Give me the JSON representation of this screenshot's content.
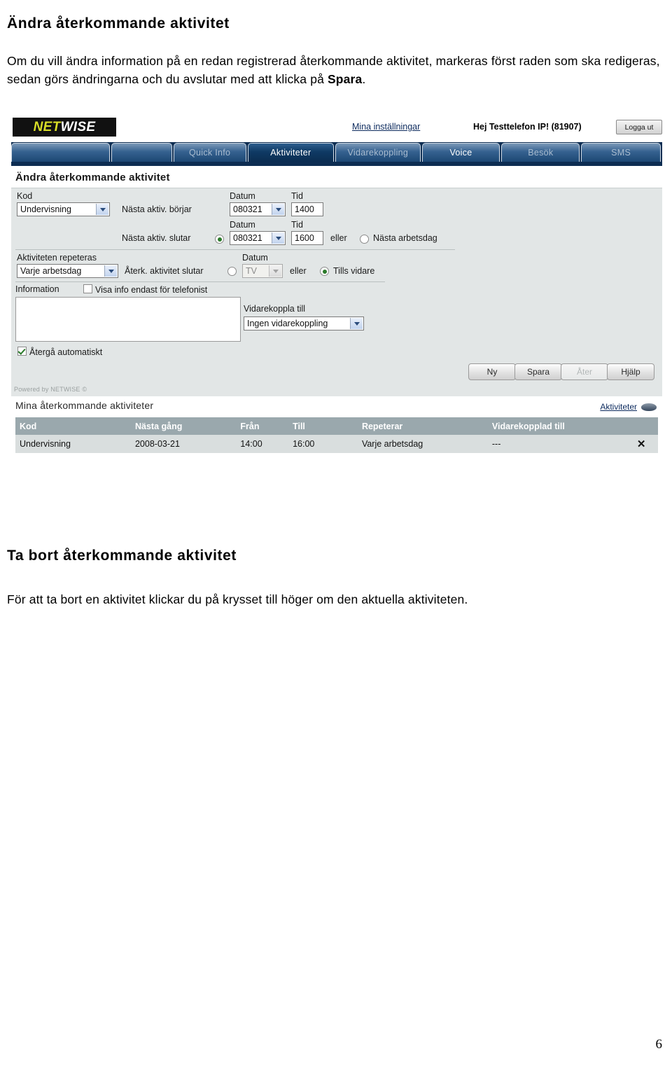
{
  "document": {
    "heading_change": "Ändra återkommande aktivitet",
    "para_change_part1": "Om du vill ändra information på en redan registrerad återkommande aktivitet, markeras först raden som ska redigeras, sedan görs ändringarna och du avslutar med att klicka på ",
    "para_change_bold": "Spara",
    "para_change_part2": ".",
    "heading_delete": "Ta bort återkommande aktivitet",
    "para_delete": "För att ta bort en aktivitet klickar du på krysset till höger om den aktuella aktiviteten.",
    "page_number": "6"
  },
  "app": {
    "logo": {
      "part_a": "NET",
      "part_b": "WISE",
      "color_a": "#d8dd27",
      "color_b": "#ffffff",
      "background": "#111111"
    },
    "header": {
      "settings_link": "Mina inställningar",
      "greeting": "Hej Testtelefon IP! (81907)",
      "logout_label": "Logga ut"
    },
    "nav_tabs": [
      {
        "label": "",
        "state": "blank"
      },
      {
        "label": "",
        "state": "blank"
      },
      {
        "label": "Quick Info",
        "state": "normal"
      },
      {
        "label": "Aktiviteter",
        "state": "active"
      },
      {
        "label": "Vidarekoppling",
        "state": "normal"
      },
      {
        "label": "Voice",
        "state": "bright"
      },
      {
        "label": "Besök",
        "state": "normal"
      },
      {
        "label": "SMS",
        "state": "normal"
      }
    ],
    "page_title": "Ändra återkommande aktivitet",
    "form": {
      "kod_label": "Kod",
      "kod_value": "Undervisning",
      "start_label": "Nästa aktiv. börjar",
      "start_date_label": "Datum",
      "start_time_label": "Tid",
      "start_date_value": "080321",
      "start_time_value": "1400",
      "end_label": "Nästa aktiv. slutar",
      "end_date_label": "Datum",
      "end_time_label": "Tid",
      "end_date_value": "080321",
      "end_time_value": "1600",
      "or_label_1": "eller",
      "next_workday_label": "Nästa arbetsdag",
      "repeat_label": "Aktiviteten repeteras",
      "repeat_value": "Varje arbetsdag",
      "repeat_end_label": "Återk. aktivitet slutar",
      "repeat_date_label": "Datum",
      "repeat_date_value": "TV",
      "or_label_2": "eller",
      "until_further_label": "Tills vidare",
      "information_label": "Information",
      "operator_only_label": "Visa info endast för telefonist",
      "info_text_value": "",
      "forward_to_label": "Vidarekoppla till",
      "forward_to_value": "Ingen vidarekoppling",
      "auto_return_label": "Återgå automatiskt",
      "powered_by": "Powered by NETWISE ©",
      "buttons": [
        {
          "label": "Ny",
          "disabled": false
        },
        {
          "label": "Spara",
          "disabled": false
        },
        {
          "label": "Åter",
          "disabled": true
        },
        {
          "label": "Hjälp",
          "disabled": false
        }
      ]
    },
    "list": {
      "title": "Mina återkommande aktiviteter",
      "link_label": "Aktiviteter",
      "columns": [
        "Kod",
        "Nästa gång",
        "Från",
        "Till",
        "Repeterar",
        "Vidarekopplad till",
        ""
      ],
      "rows": [
        {
          "kod": "Undervisning",
          "nasta_gang": "2008-03-21",
          "fran": "14:00",
          "till": "16:00",
          "repeterar": "Varje arbetsdag",
          "vidarekopplad_till": "---",
          "delete": "✕"
        }
      ]
    }
  }
}
